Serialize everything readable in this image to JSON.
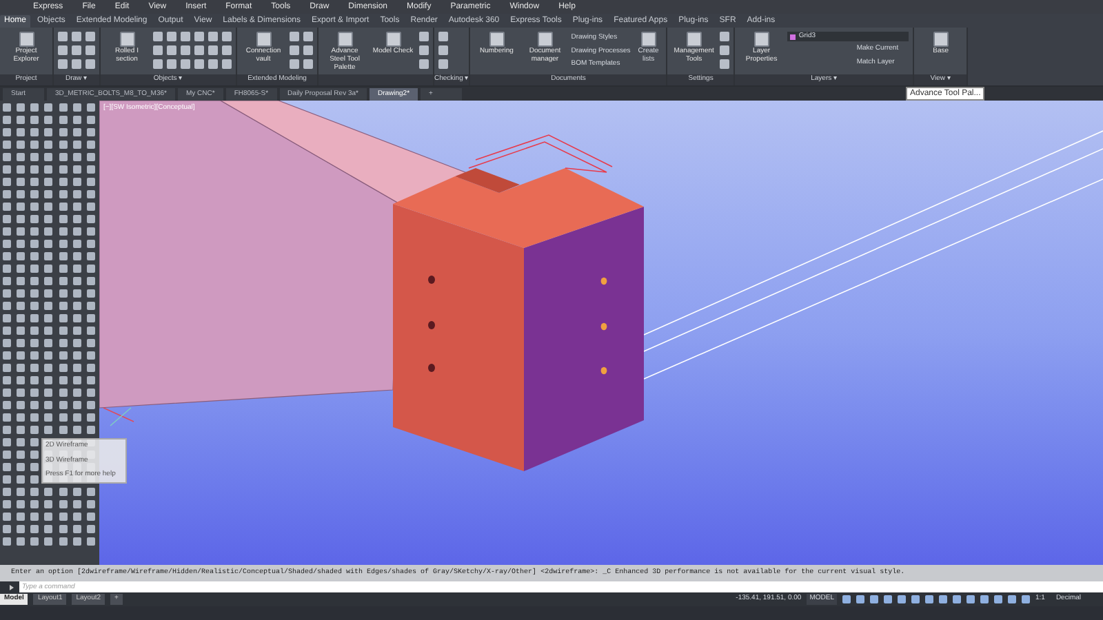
{
  "menu": [
    "Express",
    "File",
    "Edit",
    "View",
    "Insert",
    "Format",
    "Tools",
    "Draw",
    "Dimension",
    "Modify",
    "Parametric",
    "Window",
    "Help"
  ],
  "ribbon_tabs": [
    {
      "label": "Home",
      "selected": true
    },
    {
      "label": "Objects",
      "selected": false
    },
    {
      "label": "Extended Modeling",
      "selected": false
    },
    {
      "label": "Output",
      "selected": false
    },
    {
      "label": "View",
      "selected": false
    },
    {
      "label": "Labels & Dimensions",
      "selected": false
    },
    {
      "label": "Export & Import",
      "selected": false
    },
    {
      "label": "Tools",
      "selected": false
    },
    {
      "label": "Render",
      "selected": false
    },
    {
      "label": "Autodesk 360",
      "selected": false
    },
    {
      "label": "Express Tools",
      "selected": false
    },
    {
      "label": "Plug-ins",
      "selected": false
    },
    {
      "label": "Featured Apps",
      "selected": false
    },
    {
      "label": "Plug-ins",
      "selected": false
    },
    {
      "label": "SFR",
      "selected": false
    },
    {
      "label": "Add-ins",
      "selected": false
    }
  ],
  "panels": [
    {
      "title": "Project",
      "buttons": [
        "Project Explorer"
      ]
    },
    {
      "title": "Draw ▾"
    },
    {
      "title": "Objects ▾",
      "buttons": [
        "Rolled I section"
      ]
    },
    {
      "title": "Extended Modeling",
      "buttons": [
        "Connection vault"
      ]
    },
    {
      "buttons": [
        "Advance Steel Tool Palette",
        "Model Check"
      ]
    },
    {
      "title": "Checking ▾"
    },
    {
      "title": "Documents",
      "buttons": [
        "Numbering",
        "Document manager"
      ],
      "list": [
        "Drawing Styles",
        "Drawing Processes",
        "BOM Templates"
      ],
      "after": [
        "Create lists"
      ]
    },
    {
      "title": "Settings",
      "buttons": [
        "Management Tools"
      ]
    },
    {
      "title": "Layers ▾",
      "buttons": [
        "Layer Properties"
      ],
      "layer": "Grid3",
      "list": [
        "Make Current",
        "Match Layer"
      ]
    },
    {
      "title": "View ▾",
      "buttons": [
        "Base"
      ]
    }
  ],
  "doc_tabs": [
    {
      "label": "Start",
      "selected": false
    },
    {
      "label": "3D_METRIC_BOLTS_M8_TO_M36*",
      "selected": false
    },
    {
      "label": "My CNC*",
      "selected": false
    },
    {
      "label": "FH8065-S*",
      "selected": false
    },
    {
      "label": "Daily Proposal Rev 3a*",
      "selected": false
    },
    {
      "label": "Drawing2*",
      "selected": true
    },
    {
      "label": "+",
      "selected": false
    }
  ],
  "palette_tooltip": "Advance Tool Pal...",
  "viewport_label": "[−][SW Isometric][Conceptual]",
  "flyout": [
    "2D Wireframe",
    "3D Wireframe",
    "Press F1 for more help"
  ],
  "command_history": "Enter an option [2dwireframe/Wireframe/Hidden/Realistic/Conceptual/Shaded/shaded with Edges/shades of Gray/SKetchy/X-ray/Other] <2dwireframe>: _C Enhanced 3D performance is not available for the current visual style.",
  "command_placeholder": "Type a command",
  "layout_tabs": [
    {
      "label": "Model",
      "selected": true
    },
    {
      "label": "Layout1",
      "selected": false
    },
    {
      "label": "Layout2",
      "selected": false
    },
    {
      "label": "+",
      "selected": false
    }
  ],
  "status": {
    "coordinates": "-135.41, 191.51, 0.00",
    "space": "MODEL",
    "scale": "1:1",
    "units": "Decimal"
  }
}
